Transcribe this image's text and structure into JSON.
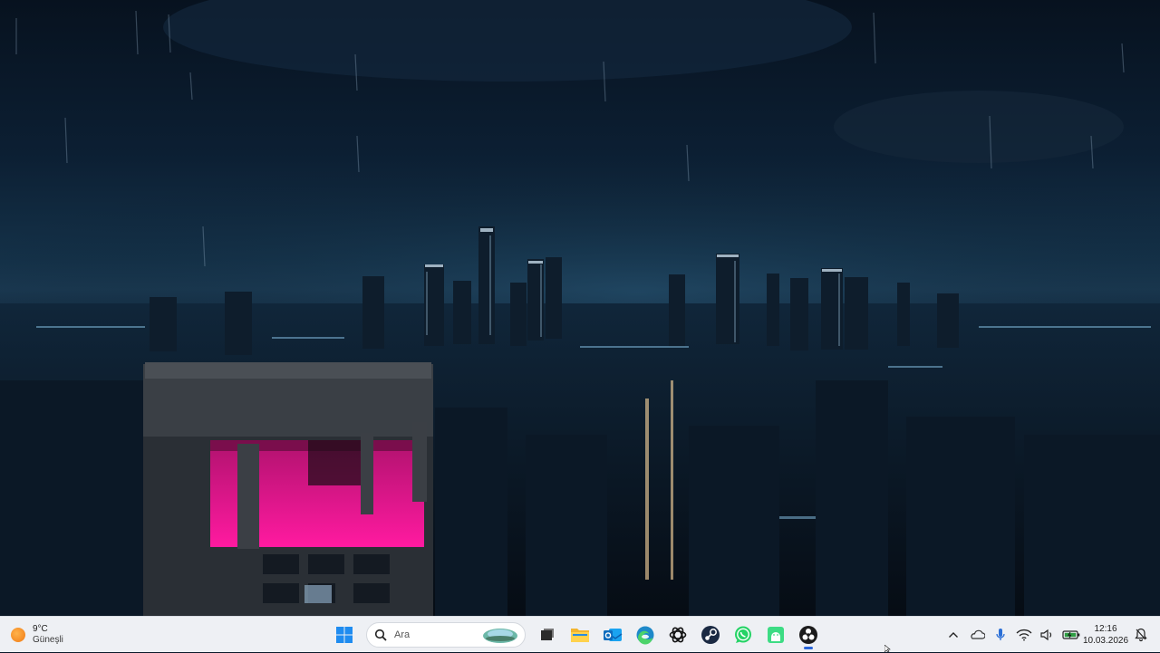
{
  "wallpaper": {
    "description_icon": "rainy-night-city-wallpaper"
  },
  "weather": {
    "temperature": "9°C",
    "condition": "Güneşli",
    "icon": "sun-icon"
  },
  "search": {
    "placeholder": "Ara"
  },
  "taskbar_apps": [
    {
      "name": "windows-start-button",
      "icon": "windows-logo-icon"
    },
    {
      "name": "task-view-button",
      "icon": "task-view-icon"
    },
    {
      "name": "file-explorer",
      "icon": "folder-icon"
    },
    {
      "name": "outlook",
      "icon": "outlook-icon"
    },
    {
      "name": "edge",
      "icon": "edge-icon"
    },
    {
      "name": "chatgpt",
      "icon": "chatgpt-icon"
    },
    {
      "name": "steam",
      "icon": "steam-icon"
    },
    {
      "name": "whatsapp",
      "icon": "whatsapp-icon"
    },
    {
      "name": "android-studio",
      "icon": "android-icon"
    },
    {
      "name": "obs-studio",
      "icon": "obs-icon",
      "active": true
    }
  ],
  "tray": {
    "icons": [
      "chevron-up-icon",
      "onedrive-icon",
      "microphone-icon",
      "wifi-icon",
      "speaker-icon",
      "battery-icon"
    ]
  },
  "clock": {
    "time": "12:16",
    "date": "10.03.2026"
  },
  "colors": {
    "taskbar_bg": "#eef0f4",
    "accent": "#2b66d9",
    "neon_pink": "#e0148c"
  }
}
